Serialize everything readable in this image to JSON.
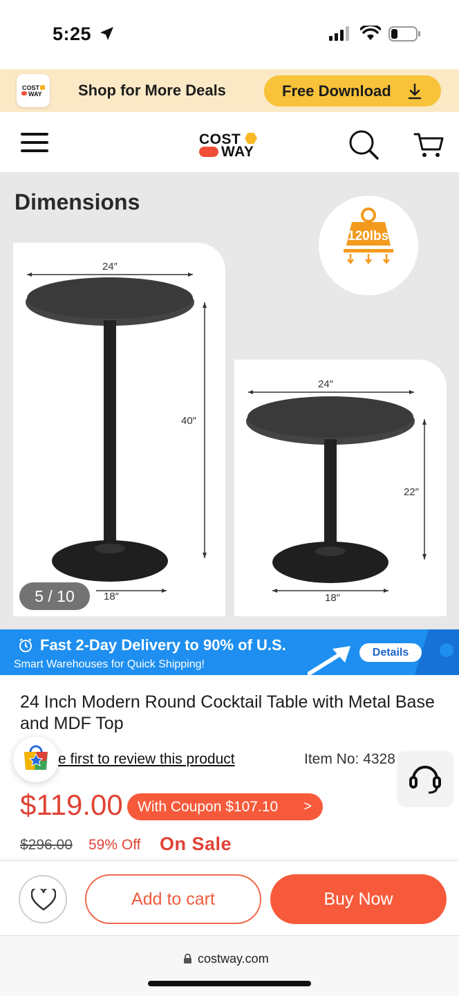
{
  "status_bar": {
    "time": "5:25"
  },
  "promo_banner": {
    "logo_text_top": "COST",
    "logo_text_bottom": "WAY",
    "text": "Shop for More Deals",
    "button_label": "Free Download"
  },
  "header": {
    "logo_top": "COST",
    "logo_bottom": "WAY"
  },
  "gallery": {
    "section_title": "Dimensions",
    "weight_label": "120lbs",
    "bar_table": {
      "width": "24″",
      "height": "40″",
      "base": "18″"
    },
    "low_table": {
      "width": "24″",
      "height": "22″",
      "base": "18″"
    },
    "page_indicator": "5 / 10"
  },
  "delivery_banner": {
    "headline": "Fast 2-Day Delivery to 90% of U.S.",
    "subtext": "Smart Warehouses for Quick Shipping!",
    "button_label": "Details"
  },
  "product": {
    "title": "24 Inch Modern Round Cocktail Table with Metal Base and MDF Top",
    "review_link": "e first to review this product",
    "item_no": "Item No: 4328",
    "price": "$119.00",
    "coupon_label": "With Coupon $107.10",
    "coupon_chevron": ">",
    "original_price": "$296.00",
    "discount": "59% Off",
    "sale_badge": "On Sale"
  },
  "actions": {
    "add_to_cart": "Add to cart",
    "buy_now": "Buy Now"
  },
  "browser": {
    "url": "costway.com"
  },
  "colors": {
    "accent_orange": "#f75a3a",
    "price_red": "#e04234",
    "promo_yellow": "#f8c33a",
    "delivery_blue": "#1e8ff0"
  }
}
